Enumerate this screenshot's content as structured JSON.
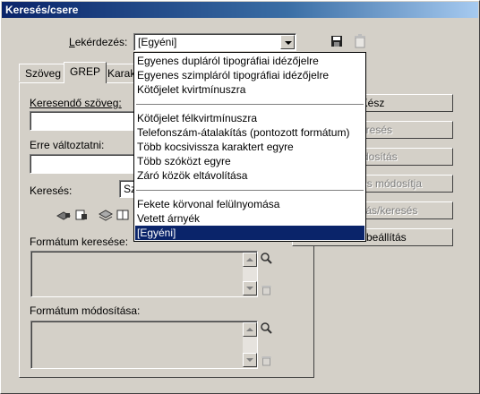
{
  "window": {
    "title": "Keresés/csere"
  },
  "query": {
    "label": "Lekérdezés:",
    "value": "[Egyéni]",
    "save_icon": "floppy-disk-icon",
    "delete_icon": "trash-can-icon"
  },
  "tabs": [
    {
      "label": "Szöveg",
      "active": false
    },
    {
      "label": "GREP",
      "active": true
    },
    {
      "label": "Karak",
      "active": false
    }
  ],
  "find": {
    "label": "Keresendő szöveg:",
    "value": ""
  },
  "change": {
    "label": "Erre változtatni:",
    "value": ""
  },
  "search": {
    "label": "Keresés:",
    "value": "Sz"
  },
  "scope_icons": [
    "lock-layers-icon",
    "lock-master-icon",
    "stacked-layers-icon",
    "book-icon"
  ],
  "format_search": {
    "label": "Formátum keresése:"
  },
  "format_change": {
    "label": "Formátum módosítása:"
  },
  "buttons": [
    {
      "text": "Kész",
      "disabled": false
    },
    {
      "text": "Keresés",
      "disabled": true
    },
    {
      "text": "Módosítás",
      "disabled": true
    },
    {
      "text": "Az összes módosítja",
      "disabled": true
    },
    {
      "text": "Módosítás/keresés",
      "disabled": true
    },
    {
      "text": "Több beállítás",
      "disabled": false
    }
  ],
  "dropdown": {
    "groups": [
      [
        "Egyenes dupláról tipográfiai idézőjelre",
        "Egyenes szimpláról tipográfiai idézőjelre",
        "Kötőjelet kvirtmínuszra"
      ],
      [
        "Kötőjelet félkvirtmínuszra",
        "Telefonszám-átalakítás (pontozott formátum)",
        "Több kocsivissza karaktert egyre",
        "Több szóközt egyre",
        "Záró közök eltávolítása"
      ],
      [
        "Fekete körvonal felülnyomása",
        "Vetett árnyék",
        "[Egyéni]"
      ]
    ],
    "selected": "[Egyéni]"
  }
}
